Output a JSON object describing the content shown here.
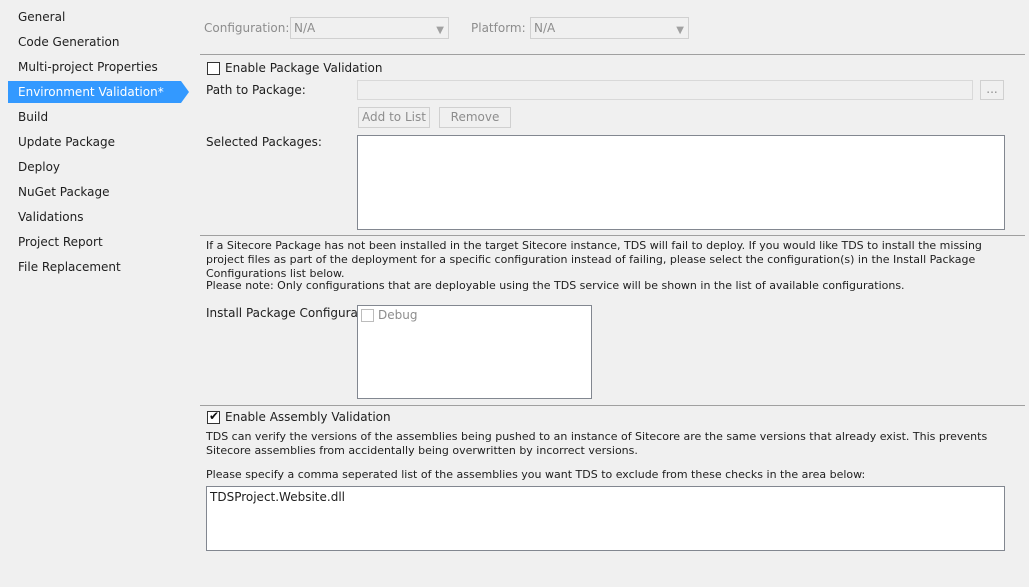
{
  "sidebar": {
    "items": [
      {
        "label": "General"
      },
      {
        "label": "Code Generation"
      },
      {
        "label": "Multi-project Properties"
      },
      {
        "label": "Environment Validation*"
      },
      {
        "label": "Build"
      },
      {
        "label": "Update Package"
      },
      {
        "label": "Deploy"
      },
      {
        "label": "NuGet Package"
      },
      {
        "label": "Validations"
      },
      {
        "label": "Project Report"
      },
      {
        "label": "File Replacement"
      }
    ],
    "active_index": 3
  },
  "header": {
    "configuration_label": "Configuration:",
    "configuration_value": "N/A",
    "platform_label": "Platform:",
    "platform_value": "N/A"
  },
  "package_validation": {
    "enable_label": "Enable Package Validation",
    "enabled": false,
    "path_label": "Path to Package:",
    "path_value": "",
    "browse_label": "...",
    "add_label": "Add to List",
    "remove_label": "Remove",
    "selected_label": "Selected Packages:",
    "info_text": "If a Sitecore Package has not been installed in the target Sitecore instance, TDS will fail to deploy. If you would like TDS to install the missing project files as part of the deployment for a specific configuration instead of failing, please select the configuration(s) in the Install Package Configurations list below.",
    "note_text": "Please note: Only configurations that are deployable using the TDS service will be shown in the list of available configurations.",
    "install_configs_label": "Install Package Configurations:",
    "install_configs": [
      {
        "label": "Debug",
        "checked": false
      }
    ]
  },
  "assembly_validation": {
    "enable_label": "Enable Assembly Validation",
    "enabled": true,
    "info_text": "TDS can verify the versions of the assemblies being pushed to an instance of Sitecore are the same versions that already exist. This prevents Sitecore assemblies from accidentally being overwritten by incorrect versions.",
    "exclude_label": "Please specify a comma seperated list of the assemblies you want TDS to exclude from these checks in the area below:",
    "exclude_value": "TDSProject.Website.dll"
  }
}
